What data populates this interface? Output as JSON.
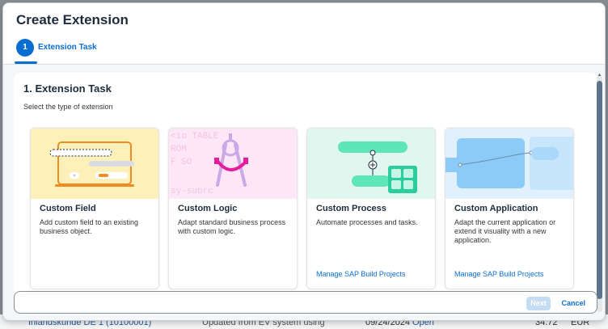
{
  "dialog": {
    "title": "Create Extension",
    "step": {
      "number": "1",
      "label": "Extension Task"
    }
  },
  "section": {
    "title": "1. Extension Task",
    "subtitle": "Select the type of extension"
  },
  "cards": [
    {
      "title": "Custom Field",
      "description": "Add custom field to an existing business object.",
      "link": "",
      "icon": "form-field-illustration"
    },
    {
      "title": "Custom Logic",
      "description": "Adapt standard business process with custom logic.",
      "link": "",
      "icon": "compass-code-illustration"
    },
    {
      "title": "Custom Process",
      "description": "Automate processes and tasks.",
      "link": "Manage SAP Build Projects",
      "icon": "process-flow-illustration"
    },
    {
      "title": "Custom Application",
      "description": "Adapt the current application or extend it visuality with a new application.",
      "link": "Manage SAP Build Projects",
      "icon": "app-window-illustration"
    }
  ],
  "illustration_text": {
    "code_line1": "<io TABLE",
    "code_line2": "ROM",
    "code_line3": "F SO",
    "code_line4": "sy-subrc"
  },
  "footer": {
    "next_label": "Next",
    "cancel_label": "Cancel"
  },
  "background_row": {
    "name": "Inlandskunde DE 1 (10100001)",
    "status": "Updated from EV system using",
    "date": "09/24/2024",
    "state": "Open",
    "amount": "34.72",
    "currency": "EUR"
  },
  "colors": {
    "accent": "#0a6ed1",
    "card1_bg": "#fdf0b8",
    "card2_bg": "#fde6f5",
    "card3_bg": "#dff7ee",
    "card4_bg": "#e0f1fd"
  }
}
